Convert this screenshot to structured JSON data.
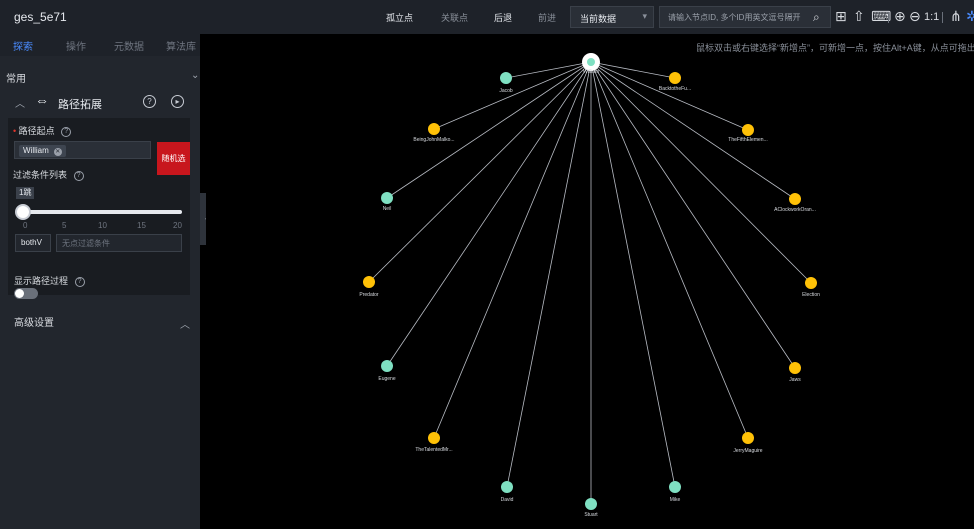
{
  "app": {
    "title": "ges_5e71"
  },
  "toolbar": {
    "isolated": "孤立点",
    "related": "关联点",
    "back": "后退",
    "forward": "前进",
    "data_select": "当前数据",
    "search_placeholder": "请输入节点ID, 多个ID用英文逗号隔开",
    "zoom_one": "1:1"
  },
  "sidebar": {
    "tabs": [
      "探索",
      "操作",
      "元数据",
      "算法库"
    ],
    "common": "常用",
    "path_title": "路径拓展",
    "start_label": "路径起点",
    "start_value": "William",
    "random_btn": "随机选",
    "filter_label": "过滤条件列表",
    "hops": "1跳",
    "ticks": [
      "0",
      "5",
      "10",
      "15",
      "20"
    ],
    "direction": "bothV",
    "condition_placeholder": "无点过滤条件",
    "show_path": "显示路径过程",
    "advanced": "高级设置"
  },
  "canvas": {
    "hint": "鼠标双击或右键选择“新增点”，可新增一点，按住Alt+A键，从点可拖出"
  },
  "colors": {
    "teal": "#7fe0c2",
    "orange": "#ffc107",
    "accent": "#4a8cff",
    "danger": "#c8161d"
  },
  "graph": {
    "center": {
      "label": "William"
    },
    "nodes": [
      {
        "label": "Jacob",
        "color": "teal"
      },
      {
        "label": "BacktotheFu...",
        "color": "orange"
      },
      {
        "label": "BeingJohnMalko...",
        "color": "orange"
      },
      {
        "label": "TheFifthElemen...",
        "color": "orange"
      },
      {
        "label": "Neil",
        "color": "teal"
      },
      {
        "label": "AClockworkOran...",
        "color": "orange"
      },
      {
        "label": "Predator",
        "color": "orange"
      },
      {
        "label": "Election",
        "color": "orange"
      },
      {
        "label": "Eugene",
        "color": "teal"
      },
      {
        "label": "Jaws",
        "color": "orange"
      },
      {
        "label": "TheTalentedMr...",
        "color": "orange"
      },
      {
        "label": "JerryMaguire",
        "color": "orange"
      },
      {
        "label": "David",
        "color": "teal"
      },
      {
        "label": "Mike",
        "color": "teal"
      },
      {
        "label": "Stuart",
        "color": "teal"
      }
    ]
  }
}
